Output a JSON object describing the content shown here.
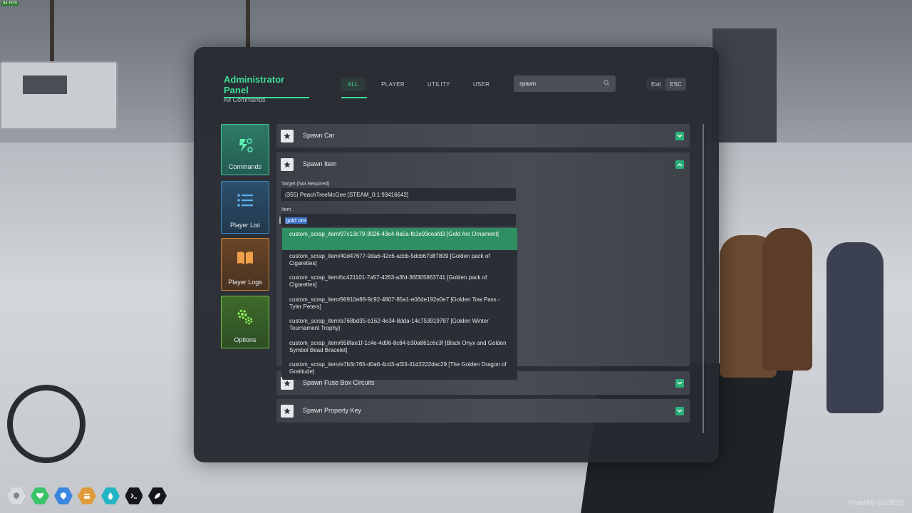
{
  "hud_top": {
    "fps": "94 FPS"
  },
  "panel": {
    "title": "Administrator Panel",
    "subtitle": "All Commands",
    "tabs": [
      {
        "label": "ALL",
        "active": true
      },
      {
        "label": "PLAYER",
        "active": false
      },
      {
        "label": "UTILITY",
        "active": false
      },
      {
        "label": "USER",
        "active": false
      }
    ],
    "search": {
      "value": "spawn"
    },
    "exit_label": "Exit",
    "esc_label": "ESC"
  },
  "sidebar": {
    "items": [
      {
        "label": "Commands",
        "icon": "commands-icon"
      },
      {
        "label": "Player List",
        "icon": "list-icon"
      },
      {
        "label": "Player Logs",
        "icon": "book-icon"
      },
      {
        "label": "Options",
        "icon": "gears-icon"
      }
    ]
  },
  "commands": {
    "spawn_car": "Spawn Car",
    "spawn_item": "Spawn Item",
    "spawn_fuse": "Spawn Fuse Box Circuits",
    "spawn_property": "Spawn Property Key"
  },
  "spawn_item_form": {
    "target_label": "Target (Not Required)",
    "target_value": "(355) PeachTreeMcGee [STEAM_0:1:93416642]",
    "item_label": "Item",
    "item_value": "gold ore"
  },
  "dropdown": {
    "options": [
      "custom_scrap_item/97c13c79-3026-43e4-8a5a-fb1e93ceafd3 [Gold Arc Ornament]",
      "custom_scrap_item/40d47677-9da6-42c6-acbb-5dcb67d87809 [Golden pack of Cigarettes]",
      "custom_scrap_item/bc421101-7a57-4263-a3fd-36f305863741 [Golden pack of Cigarettes]",
      "custom_scrap_item/96910e88-9c92-4807-85a1-e06de192e0e7 [Golden Tow Pass - Tyler Peters]",
      "custom_scrap_item/a768bd35-b162-4e34-8dda-14c753919787 [Golden Winter Tournament Trophy]",
      "custom_scrap_item/658fae1f-1c4e-4d96-8c84-b30a861c6c3f [Black Onyx and Golden Symbol Bead Bracelet]",
      "custom_scrap_item/e7b3c765-d0a6-4cd3-af33-41d2222dac29 [The Golden Dragon of Gratitude]"
    ]
  },
  "footer": {
    "watermark": "FiveM® (b2802)"
  },
  "colors": {
    "accent": "#3ddc97",
    "panel_bg": "#262a30",
    "selected_item": "#2e8f62"
  }
}
